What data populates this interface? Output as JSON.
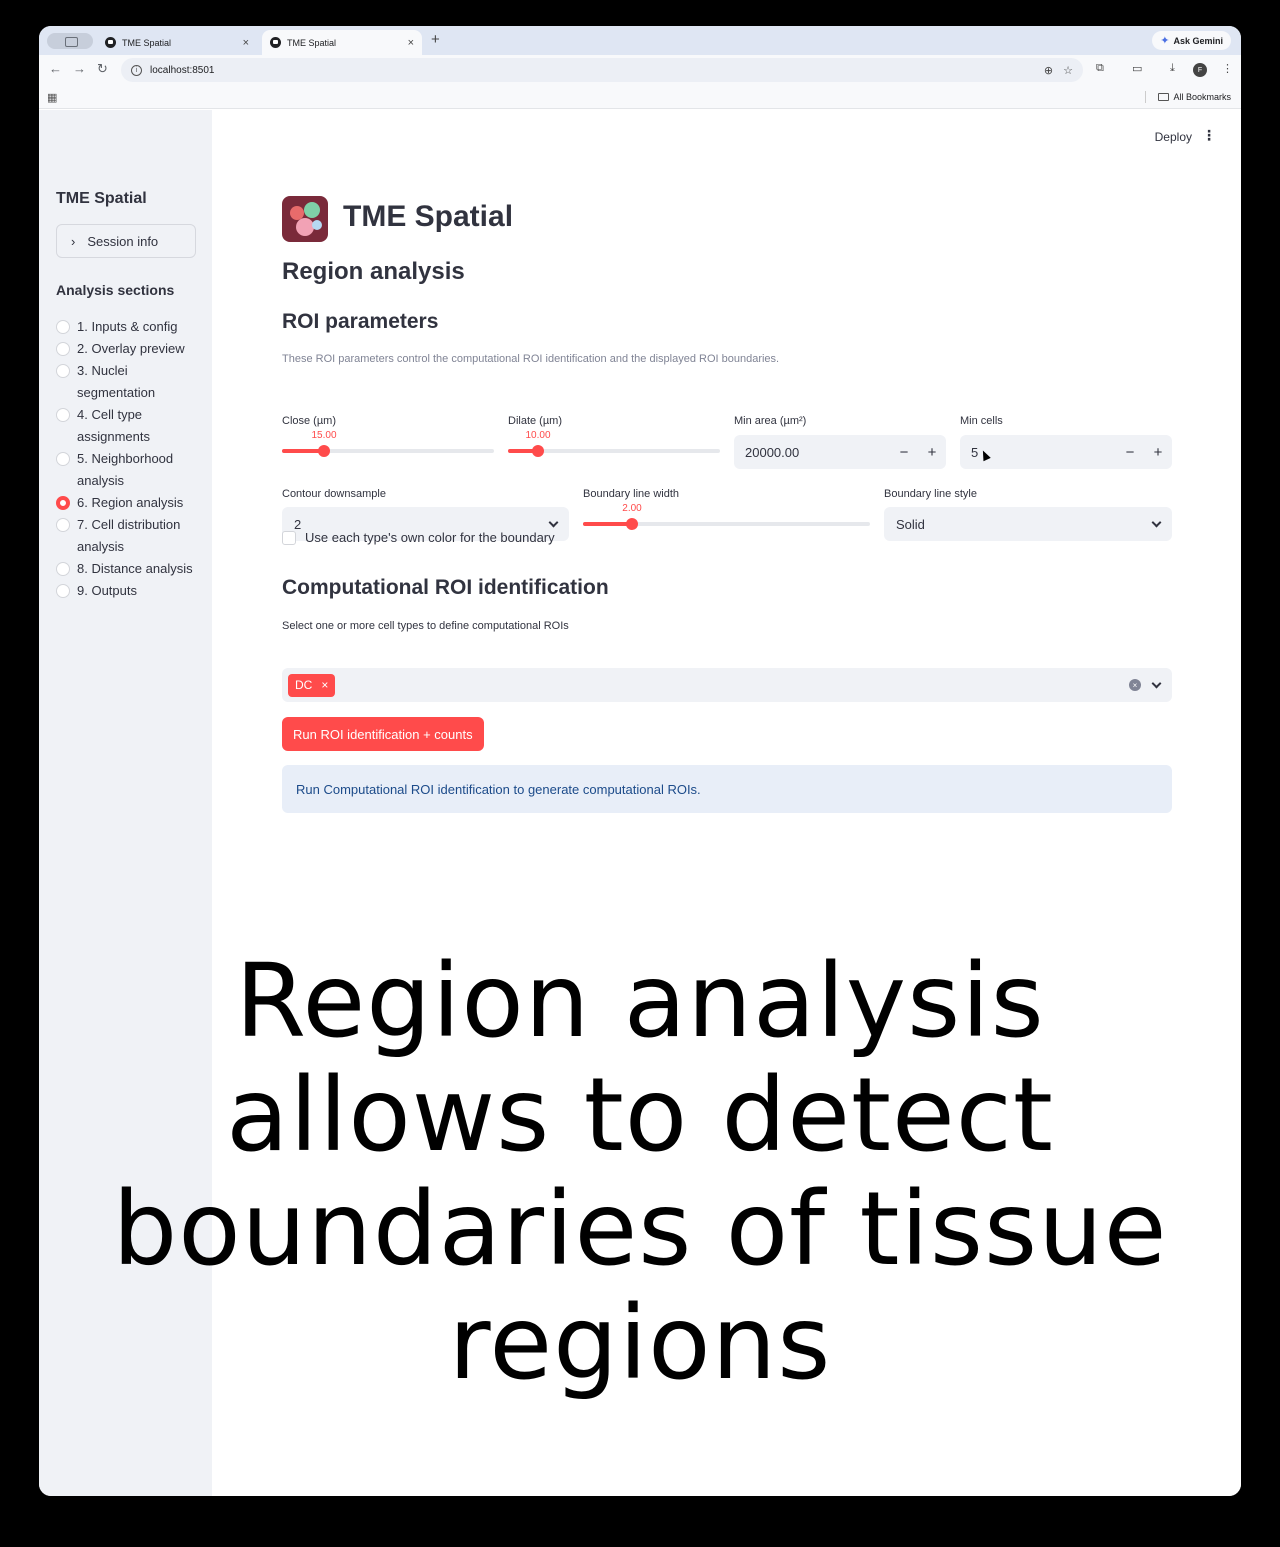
{
  "browser": {
    "tabs": [
      {
        "label": "TME Spatial",
        "active": false
      },
      {
        "label": "TME Spatial",
        "active": true
      }
    ],
    "new_tab": "+",
    "ask_gemini": "Ask Gemini",
    "url": "localhost:8501",
    "all_bookmarks": "All Bookmarks",
    "profile_initial": "F"
  },
  "header": {
    "deploy_label": "Deploy",
    "menu_icon": "⋮"
  },
  "sidebar": {
    "title": "TME Spatial",
    "session_info": "Session info",
    "sections_title": "Analysis sections",
    "items": [
      {
        "label": "1. Inputs & config",
        "selected": false
      },
      {
        "label": "2. Overlay preview",
        "selected": false
      },
      {
        "label": "3. Nuclei segmentation",
        "selected": false
      },
      {
        "label": "4. Cell type assignments",
        "selected": false
      },
      {
        "label": "5. Neighborhood analysis",
        "selected": false
      },
      {
        "label": "6. Region analysis",
        "selected": true
      },
      {
        "label": "7. Cell distribution analysis",
        "selected": false
      },
      {
        "label": "8. Distance analysis",
        "selected": false
      },
      {
        "label": "9. Outputs",
        "selected": false
      }
    ]
  },
  "main": {
    "app_title": "TME Spatial",
    "page_title": "Region analysis",
    "roi_title": "ROI parameters",
    "roi_desc": "These ROI parameters control the computational ROI identification and the displayed ROI boundaries.",
    "close": {
      "label": "Close (µm)",
      "value_text": "15.00",
      "fraction": 0.2
    },
    "dilate": {
      "label": "Dilate (µm)",
      "value_text": "10.00",
      "fraction": 0.14
    },
    "min_area": {
      "label": "Min area (µm²)",
      "value": "20000.00",
      "minus": "−",
      "plus": "+"
    },
    "min_cells": {
      "label": "Min cells",
      "value": "5",
      "minus": "−",
      "plus": "+"
    },
    "contour": {
      "label": "Contour downsample",
      "value": "2"
    },
    "boundary_width": {
      "label": "Boundary line width",
      "value_text": "2.00",
      "fraction": 0.17
    },
    "boundary_style": {
      "label": "Boundary line style",
      "value": "Solid"
    },
    "own_color_label": "Use each type's own color for the boundary",
    "comp_title": "Computational ROI identification",
    "comp_label": "Select one or more cell types to define computational ROIs",
    "selected_chip": "DC",
    "run_button": "Run ROI identification + counts",
    "info_message": "Run Computational ROI identification to generate computational ROIs."
  },
  "caption": {
    "line1": "Region analysis",
    "line2": "allows to detect",
    "line3": "boundaries of tissue",
    "line4": "regions"
  },
  "colors": {
    "accent": "#ff4b4b",
    "sidebar_bg": "#f0f2f6",
    "info_bg": "#e8eef8",
    "info_text": "#1c4b8a"
  }
}
